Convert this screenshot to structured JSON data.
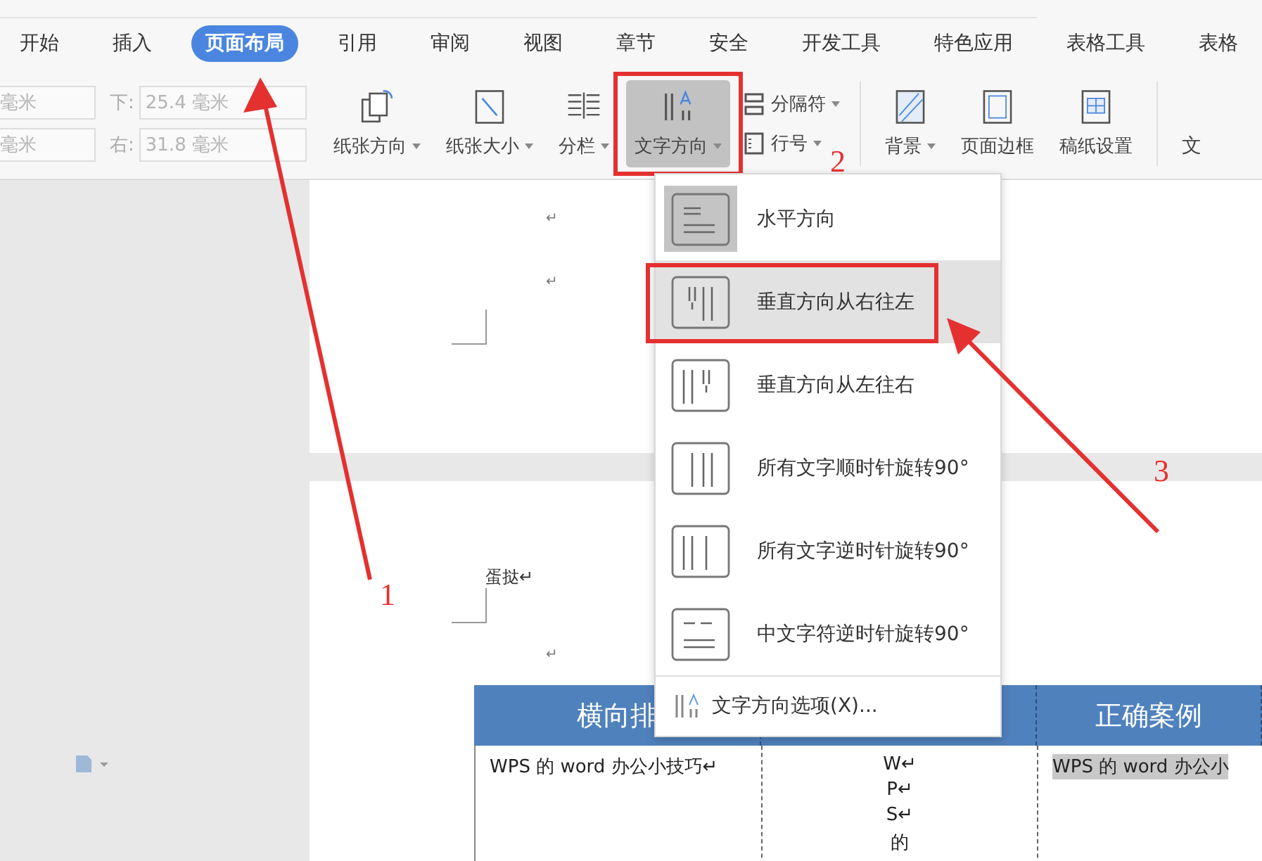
{
  "tabs": [
    {
      "label": "开始",
      "selected": false
    },
    {
      "label": "插入",
      "selected": false
    },
    {
      "label": "页面布局",
      "selected": true
    },
    {
      "label": "引用",
      "selected": false
    },
    {
      "label": "审阅",
      "selected": false
    },
    {
      "label": "视图",
      "selected": false
    },
    {
      "label": "章节",
      "selected": false
    },
    {
      "label": "安全",
      "selected": false
    },
    {
      "label": "开发工具",
      "selected": false
    },
    {
      "label": "特色应用",
      "selected": false
    },
    {
      "label": "表格工具",
      "selected": false
    },
    {
      "label": "表格",
      "selected": false
    }
  ],
  "margin_fields": [
    {
      "value": "毫米"
    },
    {
      "label": "下:",
      "value": "25.4 毫米"
    },
    {
      "value": "毫米"
    },
    {
      "label": "右:",
      "value": "31.8 毫米"
    }
  ],
  "tools": [
    {
      "label": "纸张方向",
      "kind": "large",
      "dropdown": true,
      "selected": false
    },
    {
      "label": "纸张大小",
      "kind": "large",
      "dropdown": true,
      "selected": false
    },
    {
      "label": "分栏",
      "kind": "large",
      "dropdown": true,
      "selected": false
    },
    {
      "label": "文字方向",
      "kind": "large",
      "dropdown": true,
      "selected": true
    },
    {
      "label": "分隔符",
      "kind": "small",
      "dropdown": true,
      "selected": false
    },
    {
      "label": "行号",
      "kind": "small",
      "dropdown": true,
      "selected": false
    },
    {
      "label": "背景",
      "kind": "large",
      "dropdown": true,
      "selected": false
    },
    {
      "label": "页面边框",
      "kind": "large",
      "dropdown": false,
      "selected": false
    },
    {
      "label": "稿纸设置",
      "kind": "large",
      "dropdown": false,
      "selected": false
    },
    {
      "label": "文",
      "kind": "cut",
      "dropdown": false,
      "selected": false
    }
  ],
  "menu": {
    "items": [
      {
        "label": "水平方向",
        "selected": false,
        "current": true
      },
      {
        "label": "垂直方向从右往左",
        "selected": true,
        "current": false
      },
      {
        "label": "垂直方向从左往右",
        "selected": false,
        "current": false
      },
      {
        "label": "所有文字顺时针旋转90°",
        "selected": false,
        "current": false
      },
      {
        "label": "所有文字逆时针旋转90°",
        "selected": false,
        "current": false
      },
      {
        "label": "中文字符逆时针旋转90°",
        "selected": false,
        "current": false
      }
    ],
    "footer": "文字方向选项(X)..."
  },
  "page_1": {
    "marks": [
      "↵",
      "↵"
    ]
  },
  "page_2": {
    "heading": "蛋挞↵",
    "mark": "↵",
    "table": {
      "column_1": "横向排",
      "column_3": "正确案例",
      "row": {
        "cell_1": "WPS 的 word 办公小技巧↵",
        "cell_2": [
          "W↵",
          "P↵",
          "S↵",
          "的"
        ],
        "cell_3": "WPS 的 word 办公小",
        "cell_3_highlighted": true
      }
    }
  },
  "annotations": [
    {
      "label": "1"
    },
    {
      "label": "2"
    },
    {
      "label": "3"
    }
  ]
}
